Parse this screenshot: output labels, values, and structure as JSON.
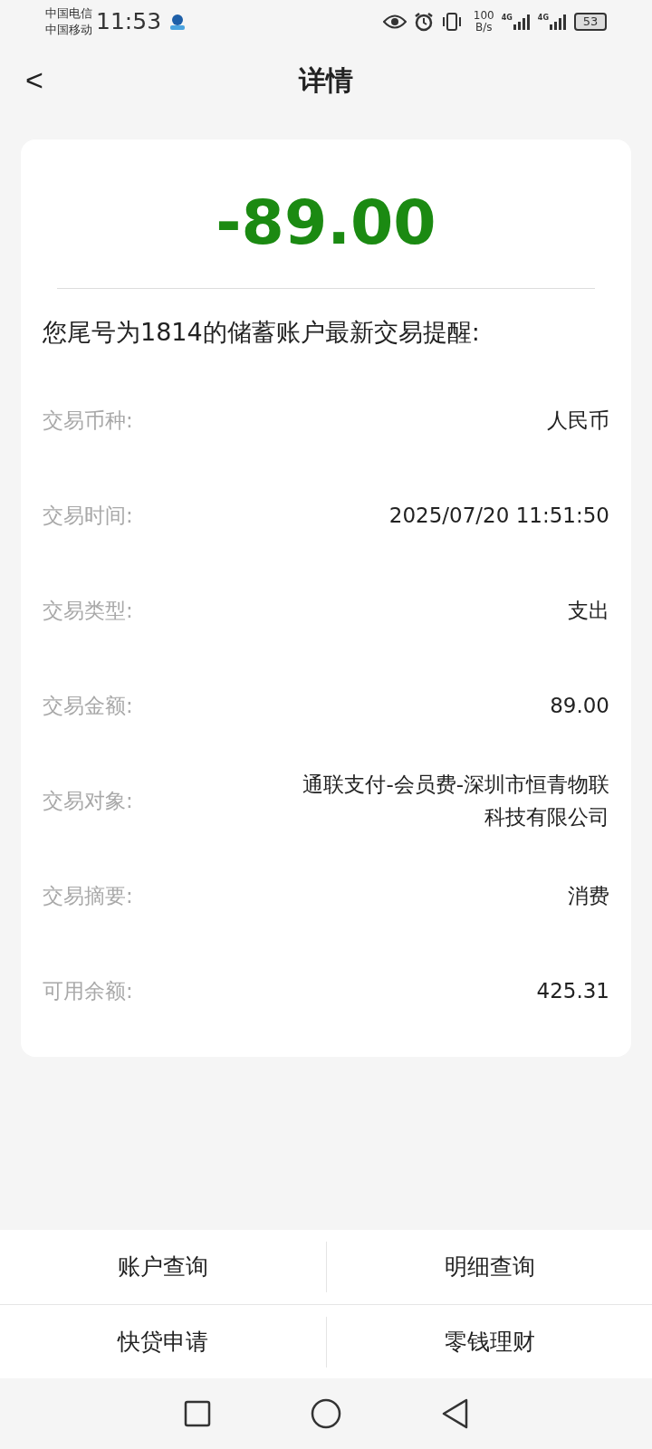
{
  "status_bar": {
    "carriers": [
      "中国电信",
      "中国移动"
    ],
    "time": "11:53",
    "speed_value": "100",
    "speed_unit": "B/s",
    "signals": [
      "4G",
      "4G"
    ],
    "battery": "53"
  },
  "header": {
    "back": "<",
    "title": "详情"
  },
  "amount": "-89.00",
  "intro": "您尾号为1814的储蓄账户最新交易提醒:",
  "details": [
    {
      "label": "交易币种:",
      "value": "人民币"
    },
    {
      "label": "交易时间:",
      "value": "2025/07/20 11:51:50"
    },
    {
      "label": "交易类型:",
      "value": "支出"
    },
    {
      "label": "交易金额:",
      "value": "89.00"
    },
    {
      "label": "交易对象:",
      "value": "通联支付-会员费-深圳市恒青物联科技有限公司"
    },
    {
      "label": "交易摘要:",
      "value": "消费"
    },
    {
      "label": "可用余额:",
      "value": "425.31"
    }
  ],
  "actions": [
    "账户查询",
    "明细查询",
    "快贷申请",
    "零钱理财"
  ]
}
